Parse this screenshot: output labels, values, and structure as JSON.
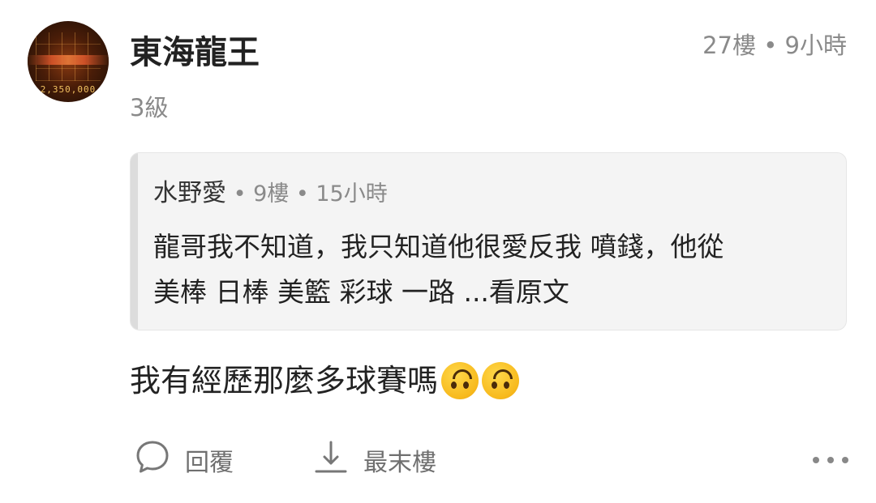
{
  "post": {
    "author": {
      "name": "東海龍王",
      "level": "3級",
      "avatar_digits": "2,350,000"
    },
    "floor_meta": "27樓 • 9小時",
    "quote": {
      "author": "水野愛",
      "meta": " • 9樓 • 15小時",
      "line1": "龍哥我不知道，我只知道他很愛反我 噴錢，他從",
      "line2": "美棒 日棒 美籃 彩球 一路 ",
      "read_more": "...看原文"
    },
    "content": "我有經歷那麼多球賽嗎"
  },
  "actions": {
    "reply_label": "回覆",
    "last_floor_label": "最末樓"
  },
  "icons": {
    "reply": "speech-bubble-icon",
    "last_floor": "arrow-down-to-line-icon",
    "more": "more-dots-icon",
    "emoji": "upside-down-face-emoji"
  }
}
